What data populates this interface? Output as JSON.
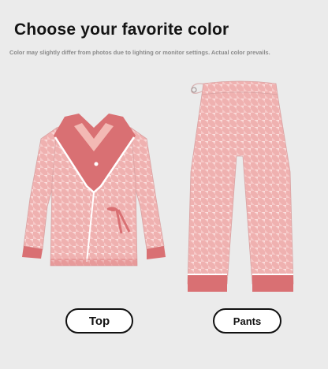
{
  "header": {
    "title": "Choose your favorite color",
    "disclaimer": "Color may slightly differ from photos due to lighting or monitor settings. Actual color prevails."
  },
  "products": [
    {
      "label": "Top",
      "icon": "pajama-top-icon"
    },
    {
      "label": "Pants",
      "icon": "pajama-pants-icon"
    }
  ],
  "colors": {
    "background": "#ebebeb",
    "fabric_base": "#f6c9c8",
    "fabric_pattern": "#e99c9c",
    "trim": "#d97073",
    "piping": "#ffffff",
    "button_border": "#111111"
  }
}
